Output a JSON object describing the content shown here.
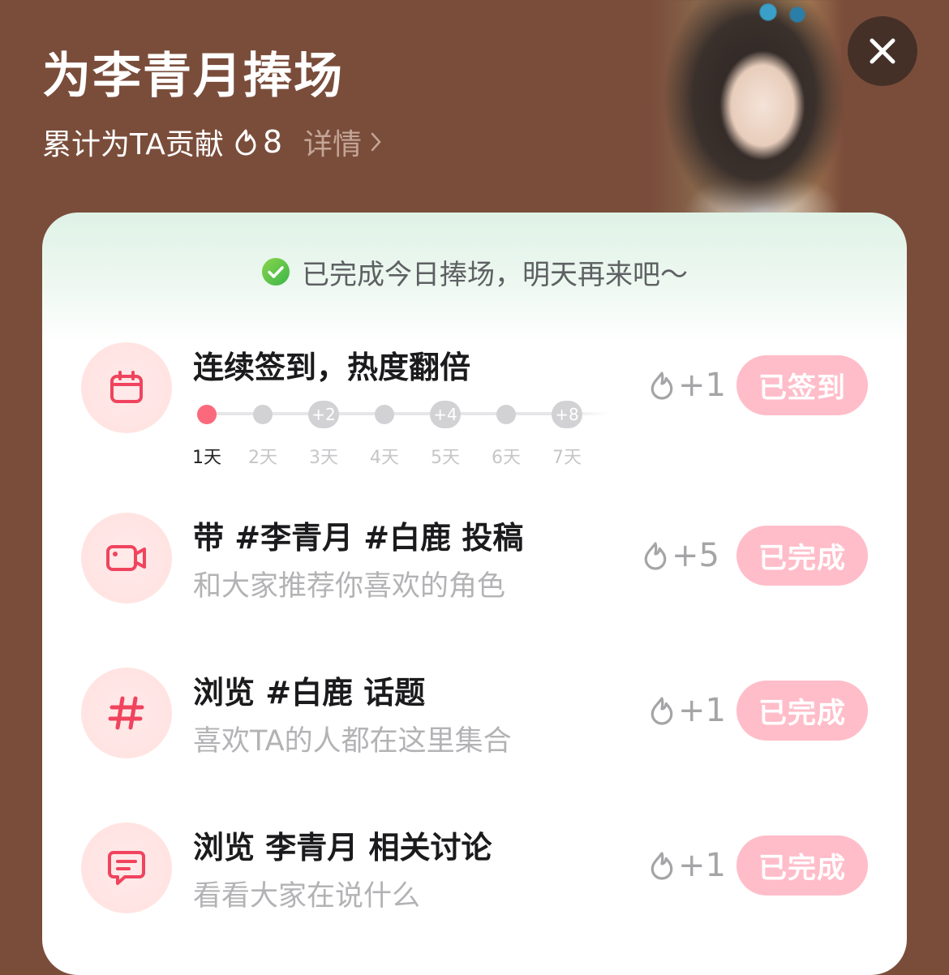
{
  "header": {
    "title": "为李青月捧场",
    "contribution_label": "累计为TA贡献",
    "contribution_count": "8",
    "detail_label": "详情"
  },
  "icons": {
    "close": "close-icon",
    "flame": "flame-icon",
    "check": "check-circle-icon",
    "chevron": "chevron-right-icon"
  },
  "notice": "已完成今日捧场，明天再来吧～",
  "tasks": [
    {
      "icon": "calendar-icon",
      "name": "连续签到，热度翻倍",
      "reward": "+1",
      "button": "已签到",
      "streak": {
        "labels": [
          "1天",
          "2天",
          "3天",
          "4天",
          "5天",
          "6天",
          "7天"
        ],
        "bonuses": [
          "",
          "",
          "+2",
          "",
          "+4",
          "",
          "+8"
        ],
        "current_day": 1
      }
    },
    {
      "icon": "video-camera-icon",
      "name": "带 #李青月 #白鹿 投稿",
      "desc": "和大家推荐你喜欢的角色",
      "reward": "+5",
      "button": "已完成"
    },
    {
      "icon": "hashtag-icon",
      "name": "浏览 #白鹿 话题",
      "desc": "喜欢TA的人都在这里集合",
      "reward": "+1",
      "button": "已完成"
    },
    {
      "icon": "chat-bubble-icon",
      "name": "浏览 李青月 相关讨论",
      "desc": "看看大家在说什么",
      "reward": "+1",
      "button": "已完成"
    }
  ],
  "colors": {
    "background": "#7a4d3b",
    "accent": "#f0445e",
    "button_done": "#ffbdc9"
  }
}
